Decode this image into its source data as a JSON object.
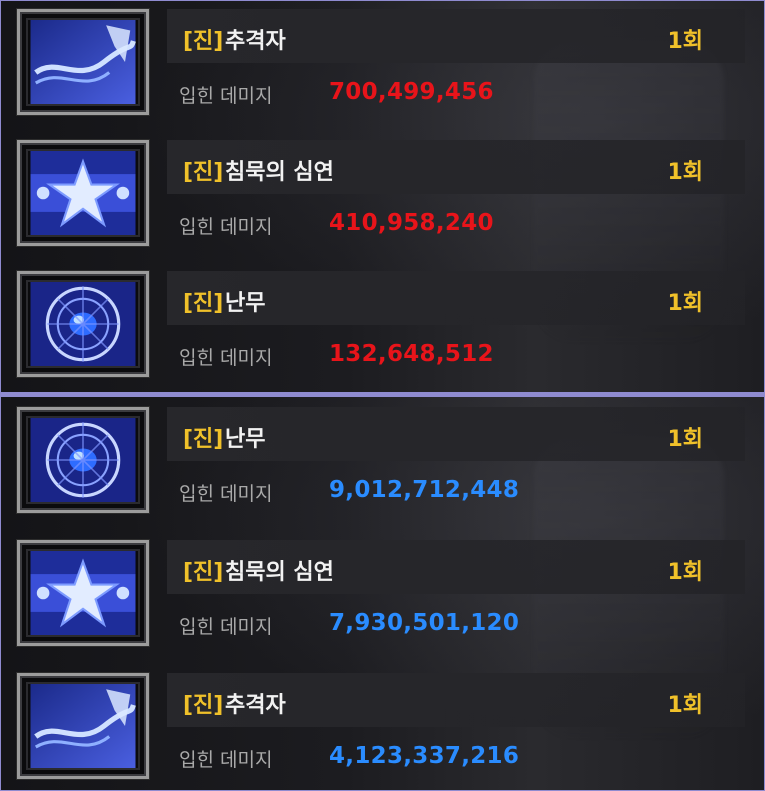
{
  "labels": {
    "tag": "[진]",
    "damage_label": "입힌 데미지",
    "count_suffix": "1회"
  },
  "colors": {
    "tag": "#f0c12a",
    "count": "#f0c12a",
    "damage_red": "#e8141a",
    "damage_blue": "#2a8cff",
    "frame_border": "#8f8bd0"
  },
  "top_panel": {
    "rows": [
      {
        "tag": "[진]",
        "name": "추격자",
        "count": "1회",
        "damage_label": "입힌 데미지",
        "damage": "700,499,456",
        "icon": "chaser-skill-icon"
      },
      {
        "tag": "[진]",
        "name": "침묵의 심연",
        "count": "1회",
        "damage_label": "입힌 데미지",
        "damage": "410,958,240",
        "icon": "abyss-of-silence-skill-icon"
      },
      {
        "tag": "[진]",
        "name": "난무",
        "count": "1회",
        "damage_label": "입힌 데미지",
        "damage": "132,648,512",
        "icon": "frenzy-skill-icon"
      }
    ]
  },
  "bottom_panel": {
    "rows": [
      {
        "tag": "[진]",
        "name": "난무",
        "count": "1회",
        "damage_label": "입힌 데미지",
        "damage": "9,012,712,448",
        "icon": "frenzy-skill-icon"
      },
      {
        "tag": "[진]",
        "name": "침묵의 심연",
        "count": "1회",
        "damage_label": "입힌 데미지",
        "damage": "7,930,501,120",
        "icon": "abyss-of-silence-skill-icon"
      },
      {
        "tag": "[진]",
        "name": "추격자",
        "count": "1회",
        "damage_label": "입힌 데미지",
        "damage": "4,123,337,216",
        "icon": "chaser-skill-icon"
      }
    ]
  }
}
